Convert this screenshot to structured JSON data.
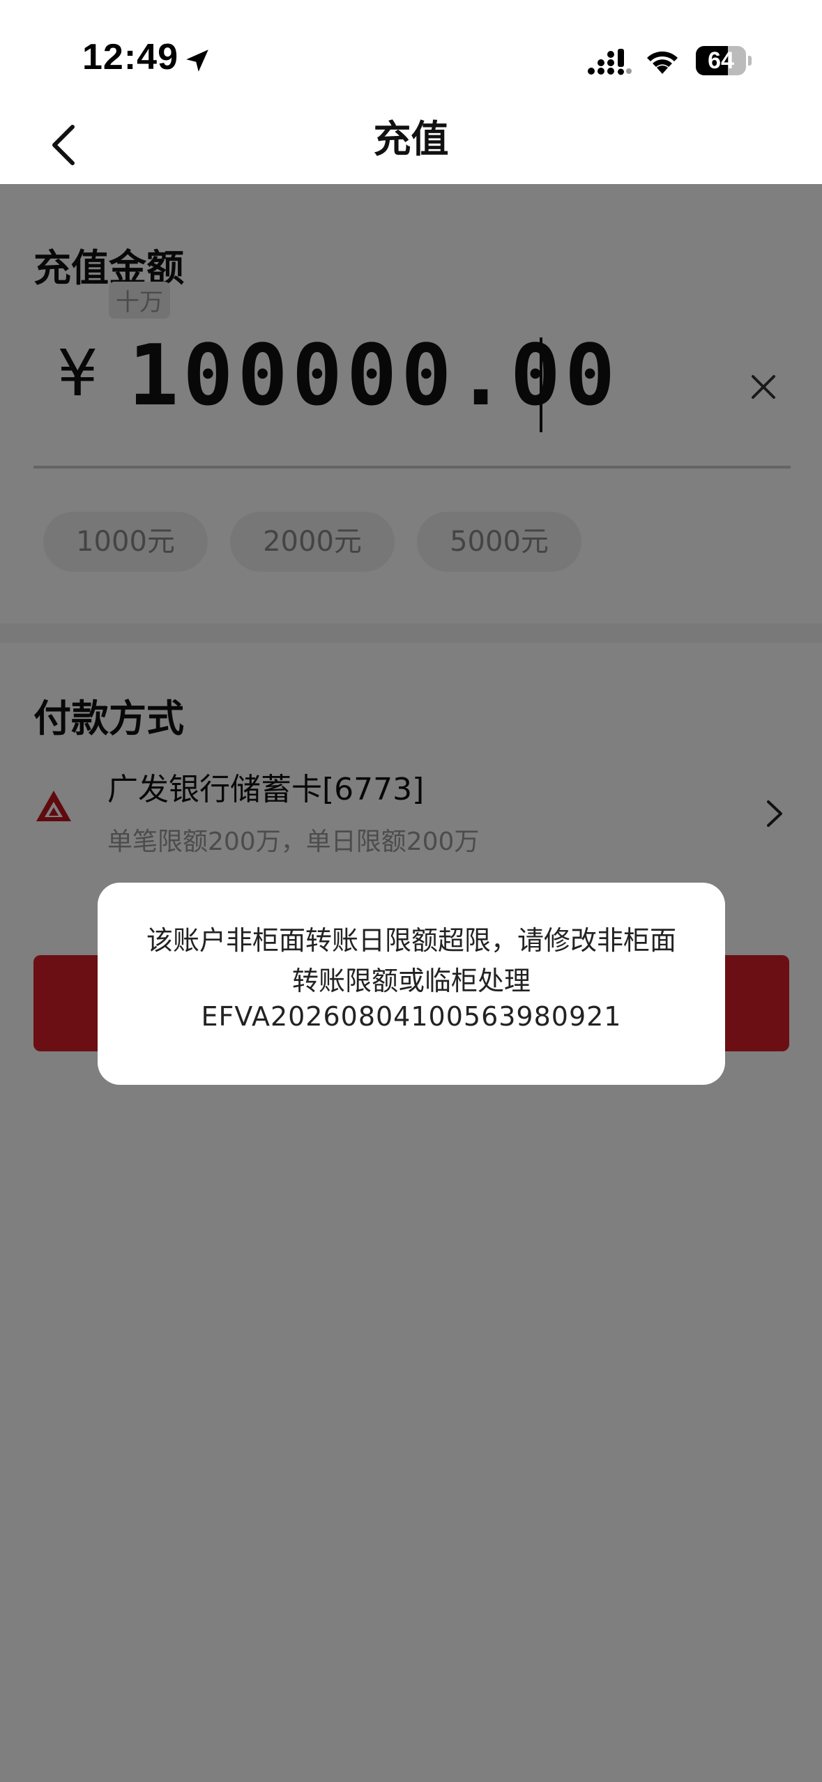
{
  "status_bar": {
    "time": "12:49",
    "battery_level": "64",
    "battery_fraction": 0.64,
    "icons": [
      "location-arrow-icon",
      "cellular-signal-icon",
      "wifi-icon",
      "battery-icon"
    ]
  },
  "nav": {
    "title": "充值",
    "back_icon": "chevron-left-icon"
  },
  "amount": {
    "section_title": "充值金额",
    "unit_hint": "十万",
    "currency_symbol": "¥",
    "value": "100000.00",
    "clear_icon": "close-icon",
    "quick_options": [
      "1000元",
      "2000元",
      "5000元"
    ]
  },
  "payment": {
    "section_title": "付款方式",
    "bank_name": "广发银行储蓄卡[6773]",
    "limit_text": "单笔限额200万，单日限额200万",
    "bank_logo_icon": "cgb-bank-logo-icon",
    "chevron_icon": "chevron-right-icon"
  },
  "dialog": {
    "message": "该账户非柜面转账日限额超限，请修改非柜面转账限额或临柜处理",
    "code": "EFVA20260804100563980921"
  },
  "colors": {
    "accent_red": "#d81e2a",
    "overlay": "rgba(0,0,0,0.5)",
    "bank_logo_red": "#c0141e"
  }
}
